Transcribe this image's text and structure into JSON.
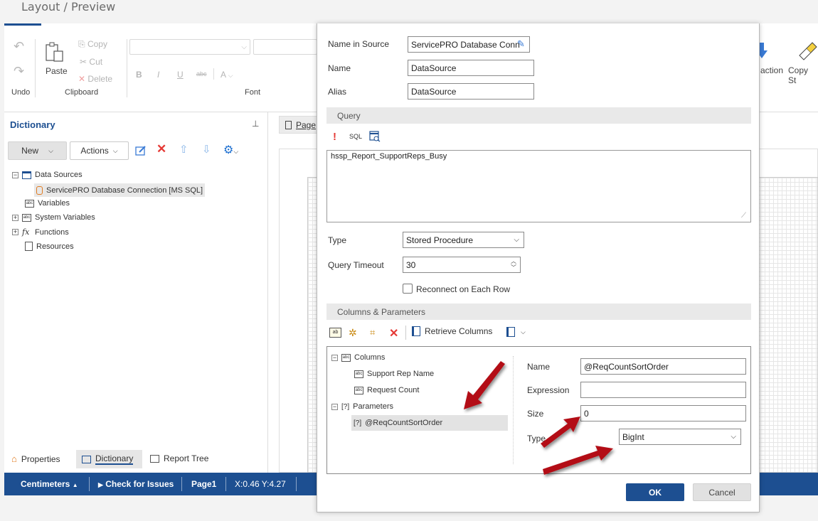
{
  "window": {
    "title": "Layout / Preview"
  },
  "ribbon": {
    "undo_label": "Undo",
    "paste_label": "Paste",
    "copy_label": "Copy",
    "cut_label": "Cut",
    "delete_label": "Delete",
    "clipboard_group": "Clipboard",
    "font_group": "Font",
    "bold": "B",
    "italic": "I",
    "underline": "U",
    "strike": "abc",
    "fontcolor": "A",
    "action_label": "action",
    "copy_style_label": "Copy St"
  },
  "dictionary": {
    "title": "Dictionary",
    "new_label": "New",
    "actions_label": "Actions",
    "tree": {
      "data_sources": "Data Sources",
      "connection": "ServicePRO Database Connection [MS SQL]",
      "variables": "Variables",
      "system_variables": "System Variables",
      "functions": "Functions",
      "resources": "Resources"
    },
    "bottom_tabs": [
      "Properties",
      "Dictionary",
      "Report Tree"
    ]
  },
  "design": {
    "page_tab": "Page"
  },
  "statusbar": {
    "units": "Centimeters",
    "check": "Check for Issues",
    "page": "Page1",
    "coords": "X:0.46 Y:4.27"
  },
  "dialog": {
    "name_in_source_label": "Name in Source",
    "name_in_source_value": "ServicePRO Database Conn",
    "name_label": "Name",
    "name_value": "DataSource",
    "alias_label": "Alias",
    "alias_value": "DataSource",
    "query_section": "Query",
    "sql_label": "SQL",
    "query_text": "hssp_Report_SupportReps_Busy",
    "type_label": "Type",
    "type_value": "Stored Procedure",
    "timeout_label": "Query Timeout",
    "timeout_value": "30",
    "reconnect_label": "Reconnect on Each Row",
    "columns_section": "Columns & Parameters",
    "retrieve_label": "Retrieve Columns",
    "tree": {
      "columns": "Columns",
      "col1": "Support Rep Name",
      "col2": "Request Count",
      "parameters": "Parameters",
      "param1": "@ReqCountSortOrder"
    },
    "param": {
      "name_label": "Name",
      "name_value": "@ReqCountSortOrder",
      "expression_label": "Expression",
      "expression_value": "",
      "size_label": "Size",
      "size_value": "0",
      "type_label": "Type",
      "type_value": "BigInt"
    },
    "ok_label": "OK",
    "cancel_label": "Cancel"
  },
  "colors": {
    "accent": "#1d4f91",
    "delete_red": "#e53935",
    "arrow_red": "#b30f16"
  }
}
